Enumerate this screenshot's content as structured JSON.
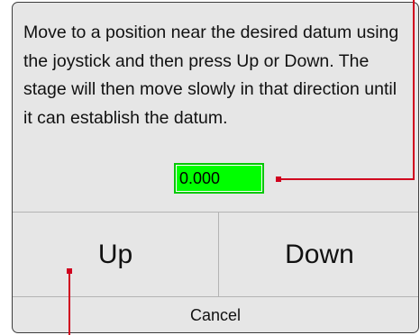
{
  "dialog": {
    "instructions": "Move to a position near the desired datum using the joystick and then press Up or Down. The stage will then move slowly in that direction until it can establish the datum.",
    "value": "0.000",
    "up_label": "Up",
    "down_label": "Down",
    "cancel_label": "Cancel"
  },
  "colors": {
    "dialog_background": "#e6e6e6",
    "value_field_background": "#00ff00",
    "annotation_marker": "#d0001e"
  }
}
